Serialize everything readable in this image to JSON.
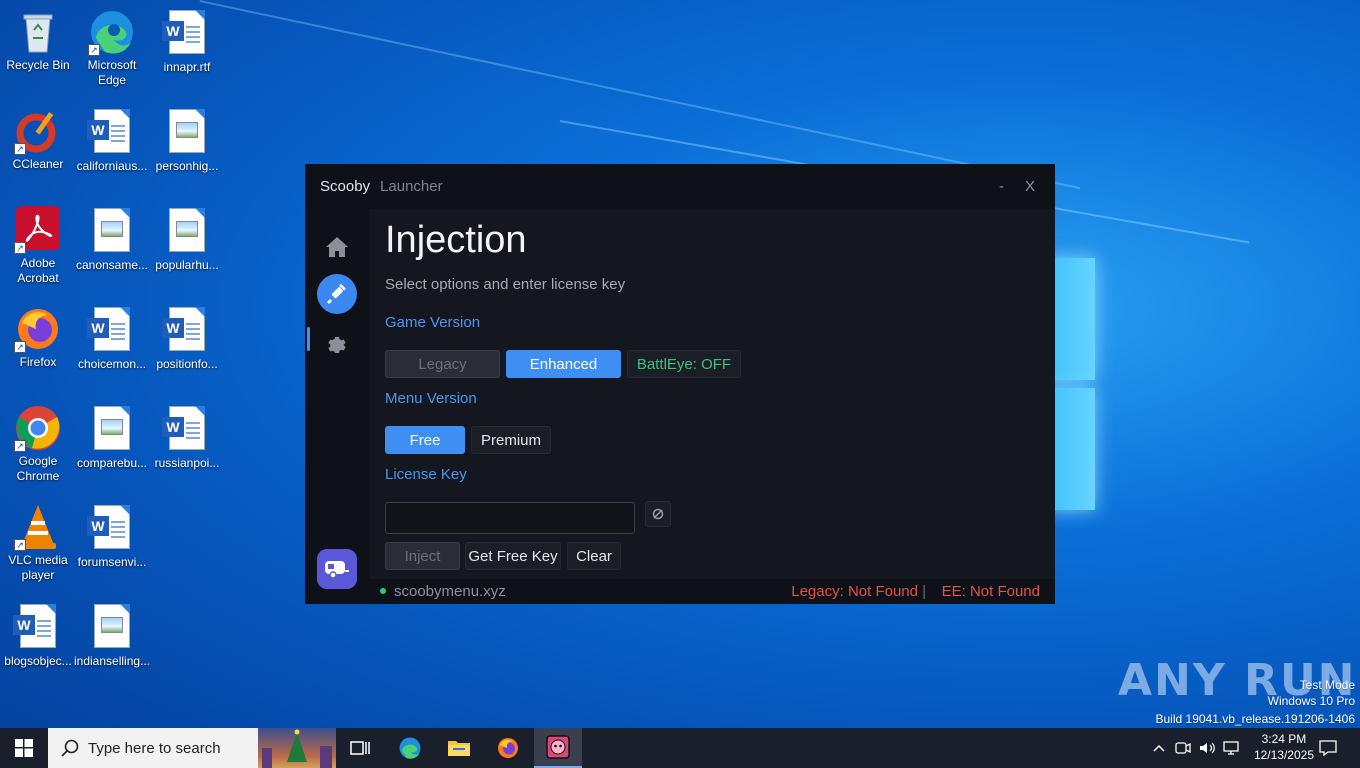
{
  "desktop_icons": [
    {
      "label": "Recycle Bin",
      "icon": "recycle-bin-icon"
    },
    {
      "label": "Microsoft Edge",
      "icon": "edge-icon"
    },
    {
      "label": "innapr.rtf",
      "icon": "word-doc-icon"
    },
    {
      "label": "CCleaner",
      "icon": "ccleaner-icon"
    },
    {
      "label": "californiaus...",
      "icon": "word-doc-icon"
    },
    {
      "label": "personhig...",
      "icon": "image-doc-icon"
    },
    {
      "label": "Adobe Acrobat",
      "icon": "acrobat-icon"
    },
    {
      "label": "canonsame...",
      "icon": "image-doc-icon"
    },
    {
      "label": "popularhu...",
      "icon": "image-doc-icon"
    },
    {
      "label": "Firefox",
      "icon": "firefox-icon"
    },
    {
      "label": "choicemon...",
      "icon": "word-doc-icon"
    },
    {
      "label": "positionfo...",
      "icon": "word-doc-icon"
    },
    {
      "label": "Google Chrome",
      "icon": "chrome-icon"
    },
    {
      "label": "comparebu...",
      "icon": "image-doc-icon"
    },
    {
      "label": "russianpoi...",
      "icon": "word-doc-icon"
    },
    {
      "label": "VLC media player",
      "icon": "vlc-icon"
    },
    {
      "label": "forumsenvi...",
      "icon": "word-doc-icon"
    },
    {
      "label": "blogsobjec...",
      "icon": "word-doc-icon"
    },
    {
      "label": "indianselling...",
      "icon": "image-doc-icon"
    }
  ],
  "app": {
    "title": "Scooby",
    "subtitle": "Launcher",
    "minimize": "-",
    "close": "X",
    "heading": "Injection",
    "description": "Select options and enter license key",
    "game_version_label": "Game Version",
    "legacy_btn": "Legacy",
    "enhanced_btn": "Enhanced",
    "battleye": "BattlEye: OFF",
    "menu_version_label": "Menu Version",
    "free_btn": "Free",
    "premium_btn": "Premium",
    "license_label": "License Key",
    "license_value": "",
    "inject_btn": "Inject",
    "free_key_btn": "Get Free Key",
    "clear_btn": "Clear",
    "site": "scoobymenu.xyz",
    "legacy_status": "Legacy: Not Found",
    "separator": "|",
    "ee_status": "EE: Not Found",
    "colors": {
      "accent": "#3f8ef2",
      "error": "#e0524a",
      "success": "#3fc17a"
    }
  },
  "taskbar": {
    "search_placeholder": "Type here to search",
    "time": "3:24 PM",
    "date": "12/13/2025"
  },
  "watermark": {
    "brand": "ANY RUN",
    "line1": "Test Mode",
    "line2": "Windows 10 Pro",
    "line3": "Build 19041.vb_release.191206-1406"
  }
}
